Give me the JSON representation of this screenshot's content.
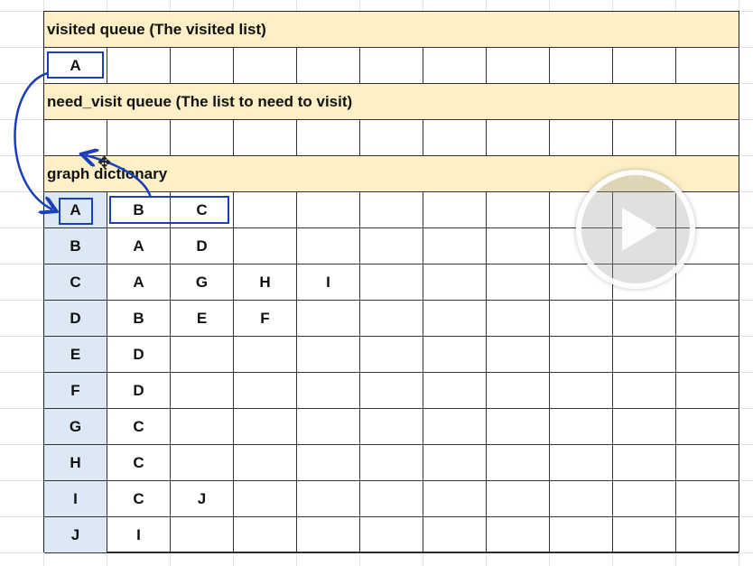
{
  "sections": {
    "visited_title": "visited queue (The visited list)",
    "need_visit_title": "need_visit queue (The list to need to visit)",
    "graph_title": "graph dictionary"
  },
  "visited_row": [
    "A",
    "",
    "",
    "",
    "",
    "",
    "",
    "",
    "",
    "",
    ""
  ],
  "need_visit_row": [
    "",
    "",
    "",
    "",
    "",
    "",
    "",
    "",
    "",
    "",
    ""
  ],
  "graph": [
    {
      "key": "A",
      "values": [
        "B",
        "C",
        "",
        "",
        "",
        "",
        "",
        "",
        "",
        ""
      ]
    },
    {
      "key": "B",
      "values": [
        "A",
        "D",
        "",
        "",
        "",
        "",
        "",
        "",
        "",
        ""
      ]
    },
    {
      "key": "C",
      "values": [
        "A",
        "G",
        "H",
        "I",
        "",
        "",
        "",
        "",
        "",
        ""
      ]
    },
    {
      "key": "D",
      "values": [
        "B",
        "E",
        "F",
        "",
        "",
        "",
        "",
        "",
        "",
        ""
      ]
    },
    {
      "key": "E",
      "values": [
        "D",
        "",
        "",
        "",
        "",
        "",
        "",
        "",
        "",
        ""
      ]
    },
    {
      "key": "F",
      "values": [
        "D",
        "",
        "",
        "",
        "",
        "",
        "",
        "",
        "",
        ""
      ]
    },
    {
      "key": "G",
      "values": [
        "C",
        "",
        "",
        "",
        "",
        "",
        "",
        "",
        "",
        ""
      ]
    },
    {
      "key": "H",
      "values": [
        "C",
        "",
        "",
        "",
        "",
        "",
        "",
        "",
        "",
        ""
      ]
    },
    {
      "key": "I",
      "values": [
        "C",
        "J",
        "",
        "",
        "",
        "",
        "",
        "",
        "",
        ""
      ]
    },
    {
      "key": "J",
      "values": [
        "I",
        "",
        "",
        "",
        "",
        "",
        "",
        "",
        "",
        ""
      ]
    }
  ],
  "overlay": {
    "play_icon": "play-icon",
    "cursor_icon": "move-cursor-icon",
    "highlight_color": "#1a3fb8",
    "band_color": "#fdefc6",
    "key_column_color": "#dde8f5"
  }
}
